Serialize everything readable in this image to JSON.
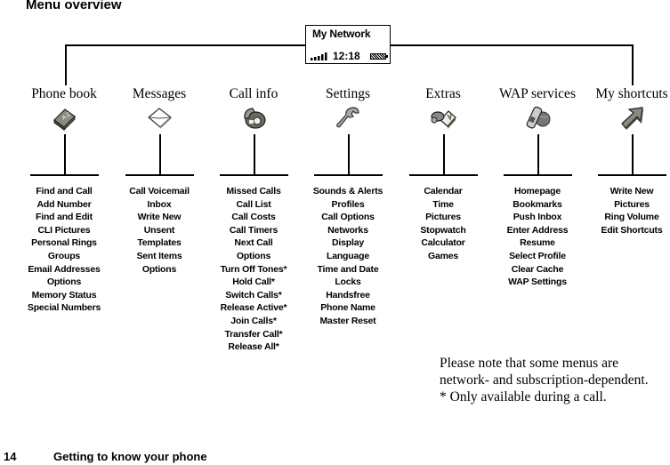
{
  "page": {
    "heading": "Menu overview",
    "page_number": "14",
    "chapter_title": "Getting to know your phone"
  },
  "phone_screen": {
    "network_name": "My Network",
    "time": "12:18",
    "signal_icon": "signal-bars-icon",
    "battery_icon": "battery-icon"
  },
  "menus": [
    {
      "title": "Phone book",
      "icon": "phonebook-icon",
      "items": [
        "Find and Call",
        "Add Number",
        "Find and Edit",
        "CLI Pictures",
        "Personal Rings",
        "Groups",
        "Email Addresses",
        "Options",
        "Memory Status",
        "Special Numbers"
      ]
    },
    {
      "title": "Messages",
      "icon": "envelope-icon",
      "items": [
        "Call Voicemail",
        "Inbox",
        "Write New",
        "Unsent",
        "Templates",
        "Sent Items",
        "Options"
      ]
    },
    {
      "title": "Call info",
      "icon": "telephone-icon",
      "items": [
        "Missed Calls",
        "Call List",
        "Call Costs",
        "Call Timers",
        "Next Call",
        "Options",
        "Turn Off Tones*",
        "Hold Call*",
        "Switch Calls*",
        "Release Active*",
        "Join Calls*",
        "Transfer Call*",
        "Release All*"
      ]
    },
    {
      "title": "Settings",
      "icon": "wrench-icon",
      "items": [
        "Sounds & Alerts",
        "Profiles",
        "Call Options",
        "Networks",
        "Display",
        "Language",
        "Time and Date",
        "Locks",
        "Handsfree",
        "Phone Name",
        "Master Reset"
      ]
    },
    {
      "title": "Extras",
      "icon": "extras-icon",
      "items": [
        "Calendar",
        "Time",
        "Pictures",
        "Stopwatch",
        "Calculator",
        "Games"
      ]
    },
    {
      "title": "WAP services",
      "icon": "wap-globe-icon",
      "items": [
        "Homepage",
        "Bookmarks",
        "Push Inbox",
        "Enter Address",
        "Resume",
        "Select Profile",
        "Clear Cache",
        "WAP Settings"
      ]
    },
    {
      "title": "My shortcuts",
      "icon": "arrow-up-right-icon",
      "items": [
        "Write New",
        "Pictures",
        "Ring Volume",
        "Edit Shortcuts"
      ]
    }
  ],
  "note": {
    "line1": "Please note that some menus are",
    "line2": "network- and subscription-dependent.",
    "line3": "* Only available during a call."
  }
}
